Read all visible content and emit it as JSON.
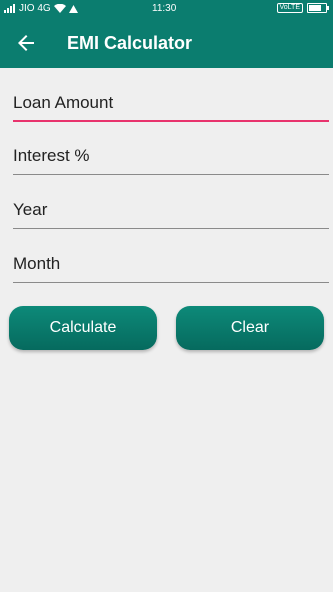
{
  "status_bar": {
    "carrier": "JIO 4G",
    "time": "11:30",
    "volte": "VoLTE",
    "battery_level": 0.75
  },
  "app_bar": {
    "title": "EMI Calculator"
  },
  "form": {
    "loan_amount_placeholder": "Loan Amount",
    "interest_placeholder": "Interest %",
    "year_placeholder": "Year",
    "month_placeholder": "Month"
  },
  "buttons": {
    "calculate": "Calculate",
    "clear": "Clear"
  },
  "colors": {
    "primary": "#0b7d6f",
    "accent": "#e8336d",
    "background": "#efefef"
  }
}
